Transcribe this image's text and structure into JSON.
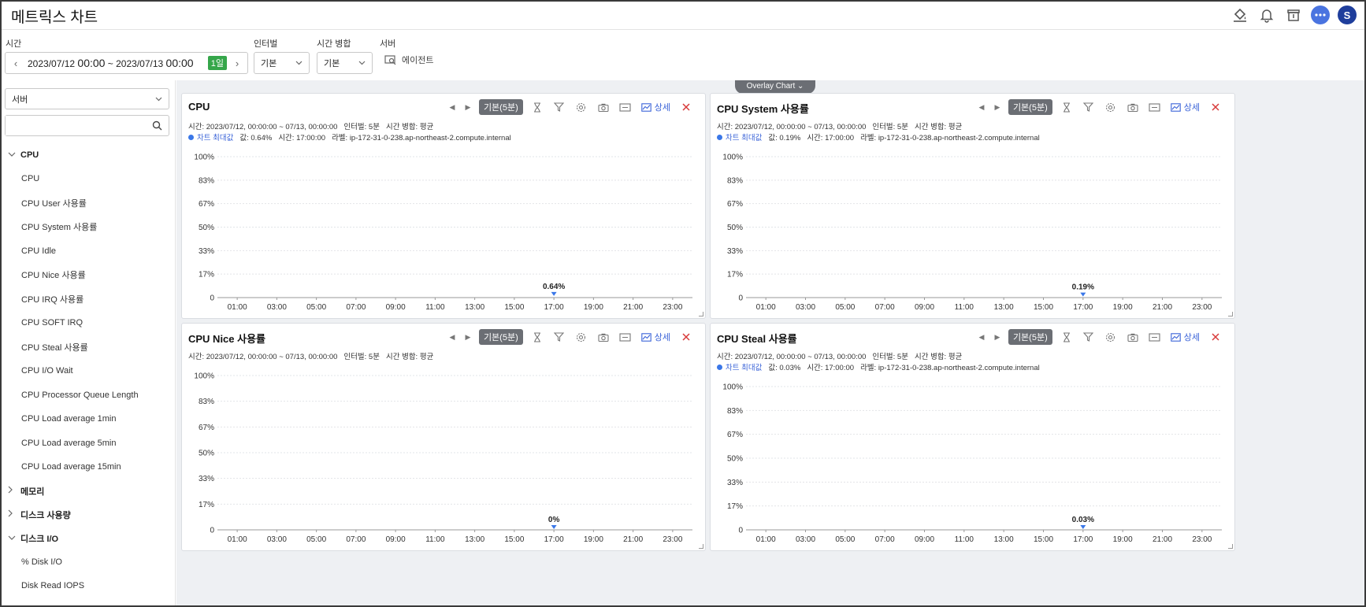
{
  "header": {
    "title": "메트릭스 차트"
  },
  "filters": {
    "time_label": "시간",
    "time_prefix": "2023/07/12 ",
    "time_start_hm": "00:00",
    "time_sep": " ~ 2023/07/13 ",
    "time_end_hm": "00:00",
    "time_badge": "1일",
    "interval_label": "인터벌",
    "interval_value": "기본",
    "merge_label": "시간 병합",
    "merge_value": "기본",
    "server_label": "서버",
    "agent_label": "에이전트"
  },
  "sidebar": {
    "select_value": "서버",
    "search_placeholder": "",
    "groups": [
      {
        "label": "CPU",
        "expanded": true,
        "items": [
          "CPU",
          "CPU User 사용률",
          "CPU System 사용률",
          "CPU Idle",
          "CPU Nice 사용률",
          "CPU IRQ 사용률",
          "CPU SOFT IRQ",
          "CPU Steal 사용률",
          "CPU I/O Wait",
          "CPU Processor Queue Length",
          "CPU Load average 1min",
          "CPU Load average 5min",
          "CPU Load average 15min"
        ]
      },
      {
        "label": "메모리",
        "expanded": false,
        "items": []
      },
      {
        "label": "디스크 사용량",
        "expanded": false,
        "items": []
      },
      {
        "label": "디스크 I/O",
        "expanded": true,
        "items": [
          "% Disk I/O",
          "Disk Read IOPS",
          "Disk Write IOPS"
        ]
      }
    ]
  },
  "overlay": {
    "label": "Overlay Chart ⌄"
  },
  "panel_tools": {
    "pill": "기본(5분)",
    "detail": "상세"
  },
  "panels": [
    {
      "title": "CPU",
      "meta_time": "시간: 2023/07/12, 00:00:00 ~ 07/13, 00:00:00",
      "meta_interval": "인터벌: 5분",
      "meta_merge": "시간 병합: 평균",
      "legend": {
        "max_label": "차트 최대값",
        "value": "값: 0.64%",
        "time": "시간: 17:00:00",
        "label": "라벨: ip-172-31-0-238.ap-northeast-2.compute.internal"
      },
      "annotation": "0.64%"
    },
    {
      "title": "CPU System 사용률",
      "meta_time": "시간: 2023/07/12, 00:00:00 ~ 07/13, 00:00:00",
      "meta_interval": "인터벌: 5분",
      "meta_merge": "시간 병합: 평균",
      "legend": {
        "max_label": "차트 최대값",
        "value": "값: 0.19%",
        "time": "시간: 17:00:00",
        "label": "라벨: ip-172-31-0-238.ap-northeast-2.compute.internal"
      },
      "annotation": "0.19%"
    },
    {
      "title": "CPU Nice 사용률",
      "meta_time": "시간: 2023/07/12, 00:00:00 ~ 07/13, 00:00:00",
      "meta_interval": "인터벌: 5분",
      "meta_merge": "시간 병합: 평균",
      "legend": null,
      "annotation": "0%"
    },
    {
      "title": "CPU Steal 사용률",
      "meta_time": "시간: 2023/07/12, 00:00:00 ~ 07/13, 00:00:00",
      "meta_interval": "인터벌: 5분",
      "meta_merge": "시간 병합: 평균",
      "legend": {
        "max_label": "차트 최대값",
        "value": "값: 0.03%",
        "time": "시간: 17:00:00",
        "label": "라벨: ip-172-31-0-238.ap-northeast-2.compute.internal"
      },
      "annotation": "0.03%"
    }
  ],
  "chart_data": [
    {
      "type": "line",
      "title": "CPU",
      "yticks": [
        "0",
        "17%",
        "33%",
        "50%",
        "67%",
        "83%",
        "100%"
      ],
      "xticks": [
        "01:00",
        "03:00",
        "05:00",
        "07:00",
        "09:00",
        "11:00",
        "13:00",
        "15:00",
        "17:00",
        "19:00",
        "21:00",
        "23:00"
      ],
      "ylim": [
        0,
        100
      ],
      "xlim": [
        0,
        24
      ],
      "series": [
        {
          "name": "ip-172-31-0-238.ap-northeast-2.compute.internal",
          "x": [
            17
          ],
          "y": [
            0.64
          ]
        }
      ],
      "annotation": {
        "x": 17,
        "y": 0.64,
        "text": "0.64%"
      },
      "grid": true,
      "color": "#3a77e8"
    },
    {
      "type": "line",
      "title": "CPU System 사용률",
      "yticks": [
        "0",
        "17%",
        "33%",
        "50%",
        "67%",
        "83%",
        "100%"
      ],
      "xticks": [
        "01:00",
        "03:00",
        "05:00",
        "07:00",
        "09:00",
        "11:00",
        "13:00",
        "15:00",
        "17:00",
        "19:00",
        "21:00",
        "23:00"
      ],
      "ylim": [
        0,
        100
      ],
      "xlim": [
        0,
        24
      ],
      "series": [
        {
          "name": "ip-172-31-0-238.ap-northeast-2.compute.internal",
          "x": [
            17
          ],
          "y": [
            0.19
          ]
        }
      ],
      "annotation": {
        "x": 17,
        "y": 0.19,
        "text": "0.19%"
      },
      "grid": true,
      "color": "#3a77e8"
    },
    {
      "type": "line",
      "title": "CPU Nice 사용률",
      "yticks": [
        "0",
        "17%",
        "33%",
        "50%",
        "67%",
        "83%",
        "100%"
      ],
      "xticks": [
        "01:00",
        "03:00",
        "05:00",
        "07:00",
        "09:00",
        "11:00",
        "13:00",
        "15:00",
        "17:00",
        "19:00",
        "21:00",
        "23:00"
      ],
      "ylim": [
        0,
        100
      ],
      "xlim": [
        0,
        24
      ],
      "series": [
        {
          "x": [
            17
          ],
          "y": [
            0
          ]
        }
      ],
      "annotation": {
        "x": 17,
        "y": 0,
        "text": "0%"
      },
      "grid": true,
      "color": "#3a77e8"
    },
    {
      "type": "line",
      "title": "CPU Steal 사용률",
      "yticks": [
        "0",
        "17%",
        "33%",
        "50%",
        "67%",
        "83%",
        "100%"
      ],
      "xticks": [
        "01:00",
        "03:00",
        "05:00",
        "07:00",
        "09:00",
        "11:00",
        "13:00",
        "15:00",
        "17:00",
        "19:00",
        "21:00",
        "23:00"
      ],
      "ylim": [
        0,
        100
      ],
      "xlim": [
        0,
        24
      ],
      "series": [
        {
          "name": "ip-172-31-0-238.ap-northeast-2.compute.internal",
          "x": [
            17
          ],
          "y": [
            0.03
          ]
        }
      ],
      "annotation": {
        "x": 17,
        "y": 0.03,
        "text": "0.03%"
      },
      "grid": true,
      "color": "#3a77e8"
    }
  ]
}
